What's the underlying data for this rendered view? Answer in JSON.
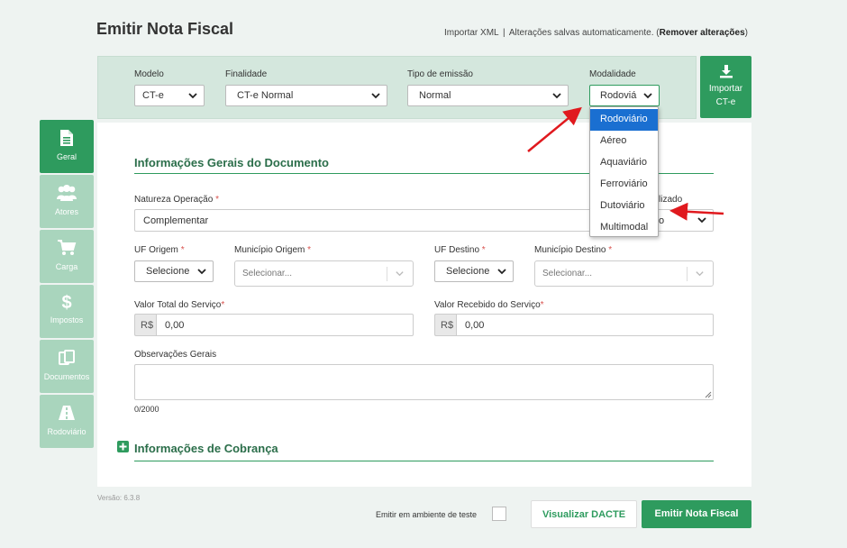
{
  "header": {
    "title": "Emitir Nota Fiscal",
    "link_import_xml": "Importar XML",
    "separator": "|",
    "autosave_text": "Alterações salvas automaticamente. (",
    "remove_changes": "Remover alterações",
    "close_paren": ")"
  },
  "top_panel": {
    "modelo": {
      "label": "Modelo",
      "value": "CT-e"
    },
    "finalidade": {
      "label": "Finalidade",
      "value": "CT-e Normal"
    },
    "tipo_emissao": {
      "label": "Tipo de emissão",
      "value": "Normal"
    },
    "modalidade": {
      "label": "Modalidade",
      "value": "Rodoviá"
    }
  },
  "import_button": {
    "line1": "Importar",
    "line2": "CT-e"
  },
  "modalidade_dropdown": {
    "options": [
      "Rodoviário",
      "Aéreo",
      "Aquaviário",
      "Ferroviário",
      "Dutoviário",
      "Multimodal"
    ],
    "selected_index": 0
  },
  "sidebar": {
    "items": [
      {
        "label": "Geral",
        "icon": "document-icon",
        "active": true
      },
      {
        "label": "Atores",
        "icon": "users-icon",
        "active": false
      },
      {
        "label": "Carga",
        "icon": "cart-icon",
        "active": false
      },
      {
        "label": "Impostos",
        "icon": "dollar-icon",
        "active": false
      },
      {
        "label": "Documentos",
        "icon": "documents-icon",
        "active": false
      },
      {
        "label": "Rodoviário",
        "icon": "road-icon",
        "active": false
      }
    ]
  },
  "form": {
    "section_title": "Informações Gerais do Documento",
    "natureza": {
      "label": "Natureza Operação",
      "required": "*",
      "value": "Complementar"
    },
    "hidden_field": {
      "label_tail": "lizado",
      "value_tail": "o"
    },
    "uf_origem": {
      "label": "UF Origem",
      "required": "*",
      "value": "Selecione"
    },
    "municipio_origem": {
      "label": "Município Origem",
      "required": "*",
      "placeholder": "Selecionar..."
    },
    "uf_destino": {
      "label": "UF Destino",
      "required": "*",
      "value": "Selecione"
    },
    "municipio_destino": {
      "label": "Município Destino",
      "required": "*",
      "placeholder": "Selecionar..."
    },
    "valor_total": {
      "label": "Valor Total do Serviço",
      "required": "*",
      "prefix": "R$",
      "value": "0,00"
    },
    "valor_recebido": {
      "label": "Valor Recebido do Serviço",
      "required": "*",
      "prefix": "R$",
      "value": "0,00"
    },
    "observacoes": {
      "label": "Observações Gerais",
      "counter": "0/2000"
    },
    "cobranca_title": "Informações de Cobrança"
  },
  "footer": {
    "version": "Versão: 6.3.8",
    "test_env_label": "Emitir em ambiente de teste",
    "btn_dacte": "Visualizar DACTE",
    "btn_emit": "Emitir Nota Fiscal"
  },
  "colors": {
    "primary_green": "#2e9b5e",
    "light_green": "#a9d5bd",
    "panel_green": "#d4e7dd",
    "selected_blue": "#1a6fd1",
    "arrow_red": "#e0191e"
  }
}
